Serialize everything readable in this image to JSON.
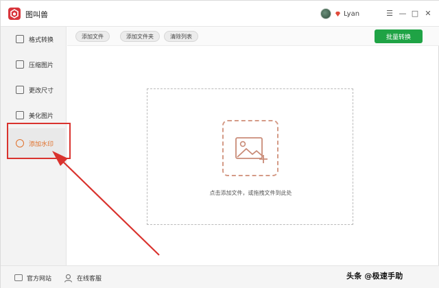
{
  "app": {
    "title": "图叫兽"
  },
  "user": {
    "name": "Lyan"
  },
  "window_controls": {
    "menu": "☰",
    "minimize": "—",
    "maximize": "□",
    "close": "✕"
  },
  "sidebar": {
    "items": [
      {
        "label": "格式转换",
        "icon": "format-convert-icon"
      },
      {
        "label": "压缩图片",
        "icon": "compress-image-icon"
      },
      {
        "label": "更改尺寸",
        "icon": "resize-icon"
      },
      {
        "label": "美化图片",
        "icon": "beautify-image-icon"
      },
      {
        "label": "添加水印",
        "icon": "watermark-icon",
        "active": true
      }
    ]
  },
  "toolbar": {
    "add_file": "添加文件",
    "add_folder": "添加文件夹",
    "clear_list": "清除列表",
    "batch_convert": "批量转换"
  },
  "dropzone": {
    "hint": "点击添加文件，或拖拽文件到此处"
  },
  "footer": {
    "website": "官方网站",
    "support": "在线客服"
  },
  "watermark_text": "头条 @极速手助",
  "colors": {
    "accent": "#e0702a",
    "primary_button": "#1fa345",
    "annotation": "#d9322d",
    "logo": "#d8353b"
  }
}
